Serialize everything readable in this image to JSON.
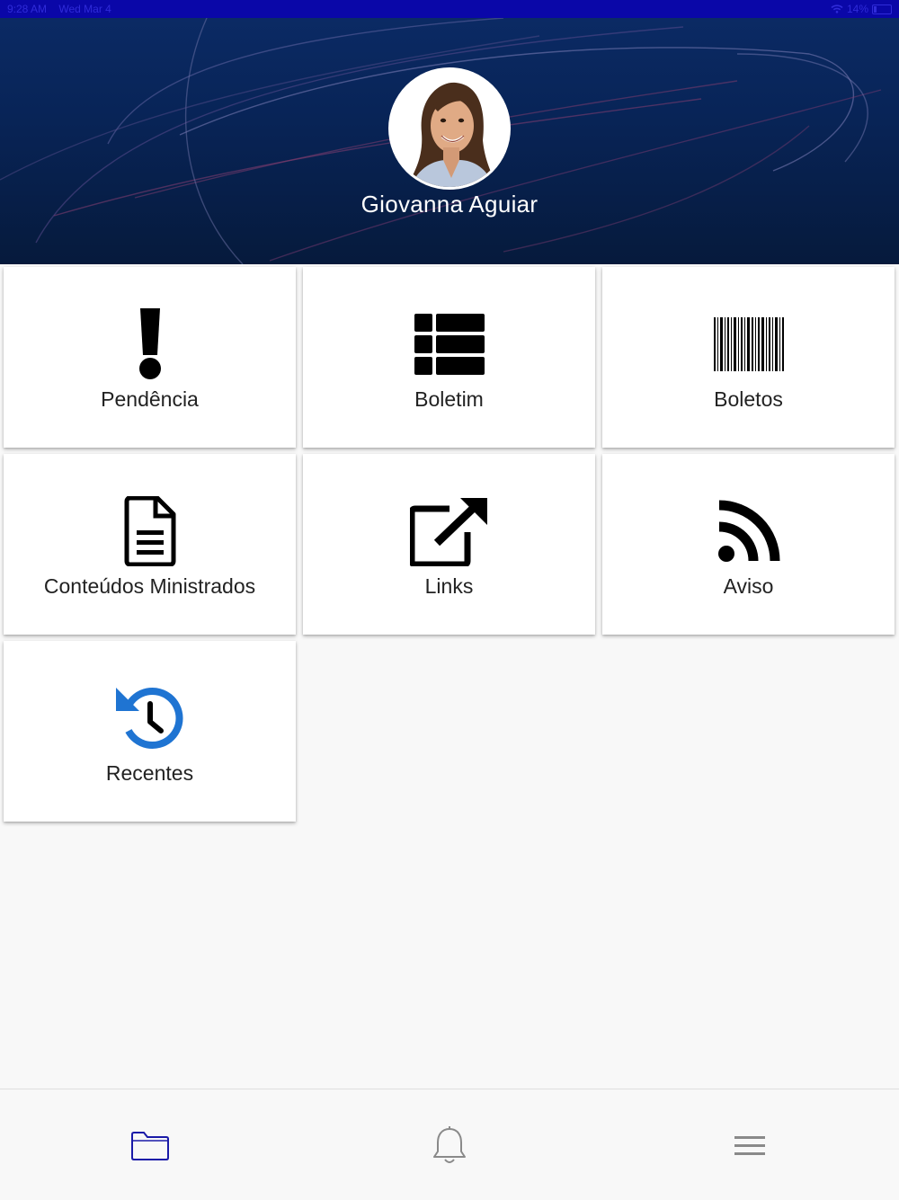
{
  "status_bar": {
    "time": "9:28 AM",
    "date": "Wed Mar 4",
    "battery": "14%"
  },
  "profile": {
    "name": "Giovanna Aguiar"
  },
  "tiles": [
    {
      "label": "Pendência",
      "icon": "exclamation-icon"
    },
    {
      "label": "Boletim",
      "icon": "table-list-icon"
    },
    {
      "label": "Boletos",
      "icon": "barcode-icon"
    },
    {
      "label": "Conteúdos Ministrados",
      "icon": "document-icon"
    },
    {
      "label": "Links",
      "icon": "external-link-icon"
    },
    {
      "label": "Aviso",
      "icon": "rss-icon"
    },
    {
      "label": "Recentes",
      "icon": "history-icon"
    }
  ],
  "bottom_nav": [
    {
      "icon": "folder-icon",
      "active": true
    },
    {
      "icon": "bell-icon",
      "active": false
    },
    {
      "icon": "menu-icon",
      "active": false
    }
  ],
  "colors": {
    "status_bar": "#0a07a8",
    "header": "#082457",
    "accent_blue": "#1f74d2",
    "nav_active": "#1a1aa8",
    "nav_inactive": "#8a8a8a"
  }
}
